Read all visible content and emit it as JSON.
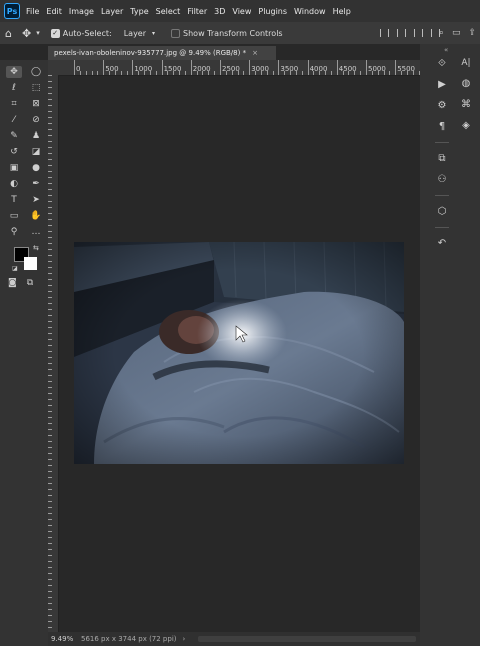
{
  "app": {
    "logo_text": "Ps",
    "menu": [
      "File",
      "Edit",
      "Image",
      "Layer",
      "Type",
      "Select",
      "Filter",
      "3D",
      "View",
      "Plugins",
      "Window",
      "Help"
    ]
  },
  "options_bar": {
    "auto_select_label": "Auto-Select:",
    "auto_select_checked": true,
    "auto_select_target": "Layer",
    "show_transform_label": "Show Transform Controls",
    "show_transform_checked": false
  },
  "document": {
    "tab_title": "pexels-ivan-oboleninov-935777.jpg @ 9.49% (RGB/8) *",
    "tab_close": "×"
  },
  "ruler": {
    "top_labels": [
      "0",
      "500",
      "1000",
      "1500",
      "2000",
      "2500",
      "3000",
      "3500",
      "4000",
      "4500",
      "5000",
      "5500"
    ]
  },
  "status": {
    "zoom": "9.49%",
    "dimensions": "5616 px x 3744 px (72 ppi)",
    "arrow": "›"
  },
  "panels": {
    "character_label": "A|"
  },
  "colors": {
    "foreground": "#000000",
    "background": "#ffffff",
    "accent": "#31a8ff"
  }
}
